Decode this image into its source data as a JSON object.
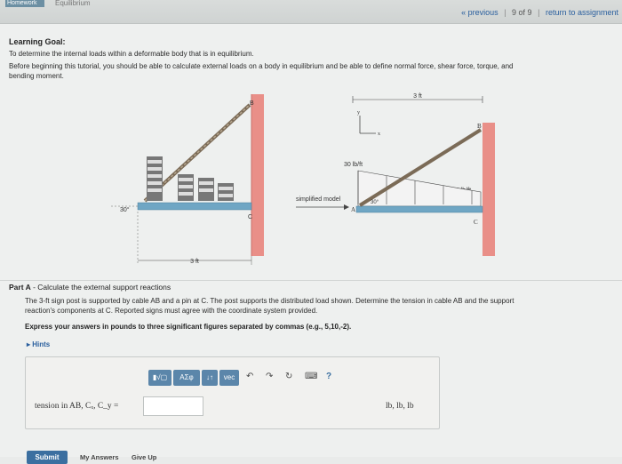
{
  "header": {
    "tab_homework": "Homework",
    "tab_equilibrium": "Equilibrium",
    "previous": "« previous",
    "position": "9 of 9",
    "return": "return to assignment"
  },
  "learning_goal": {
    "title": "Learning Goal:",
    "line1": "To determine the internal loads within a deformable body that is in equilibrium.",
    "line2": "Before beginning this tutorial, you should be able to calculate external loads on a body in equilibrium and be able to define normal force, shear force, torque, and",
    "line3": "bending moment."
  },
  "figure": {
    "left_B": "B",
    "left_C": "C",
    "left_angle": "30°",
    "left_dim": "3 ft",
    "right_dim": "3 ft",
    "y_label": "y",
    "x_label": "x",
    "load_30": "30 lb/ft",
    "load_20": "20 lb/ft",
    "simplified": "simplified model",
    "right_B": "B",
    "right_A": "A",
    "right_C": "C",
    "right_angle": "30°"
  },
  "part_a": {
    "title_bold": "Part A",
    "title_rest": " - Calculate the external support reactions",
    "line1": "The 3-ft sign post is supported by cable AB and a pin at C. The post supports the distributed load shown. Determine the tension in cable AB and the support",
    "line2": "reaction's components at C. Reported signs must agree with the coordinate system provided.",
    "express": "Express your answers in pounds to three significant figures separated by commas (e.g., 5,10,-2).",
    "hints": "▸ Hints"
  },
  "answer": {
    "tb_sqrt": "▮√▢",
    "tb_greek": "AΣφ",
    "tb_arrows": "↓↑",
    "tb_vec": "vec",
    "label": "tension in AB, Cₓ, C_y =",
    "input_value": "",
    "units": "lb, lb, lb"
  },
  "actions": {
    "submit": "Submit",
    "my_answers": "My Answers",
    "give_up": "Give Up"
  }
}
